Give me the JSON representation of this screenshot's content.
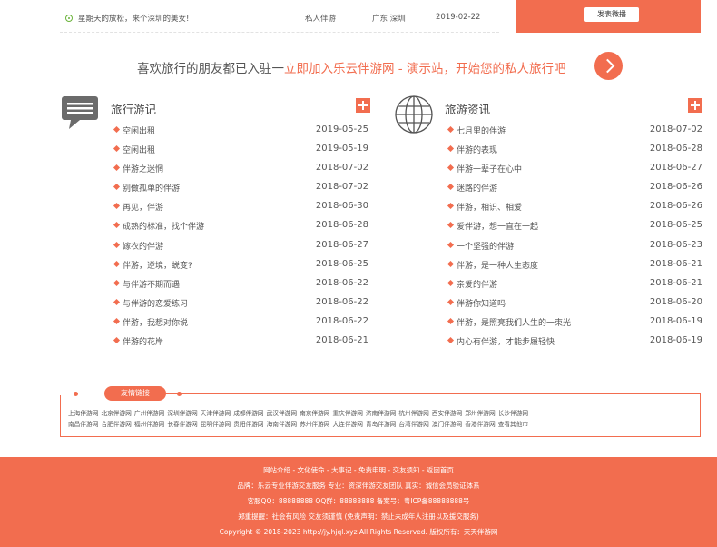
{
  "top_row": {
    "title": "星期天的放松，来个深圳的美女!",
    "category": "私人伴游",
    "location": "广东 深圳",
    "date": "2019-02-22",
    "post_button": "发表微播"
  },
  "banner": {
    "prefix": "喜欢旅行的朋友都已入驻一",
    "highlight": "立即加入乐云伴游网 - 演示站，开始您的私人旅行吧"
  },
  "travel_notes": {
    "title": "旅行游记",
    "icon": "chat-bubble-icon",
    "items": [
      {
        "title": "空闲出租",
        "date": "2019-05-25"
      },
      {
        "title": "空闲出租",
        "date": "2019-05-19"
      },
      {
        "title": "伴游之迷惘",
        "date": "2018-07-02"
      },
      {
        "title": "别做孤单的伴游",
        "date": "2018-07-02"
      },
      {
        "title": "再见，伴游",
        "date": "2018-06-30"
      },
      {
        "title": "成熟的标准，找个伴游",
        "date": "2018-06-28"
      },
      {
        "title": "嫁衣的伴游",
        "date": "2018-06-27"
      },
      {
        "title": "伴游，逆境，蜕变?",
        "date": "2018-06-25"
      },
      {
        "title": "与伴游不期而遇",
        "date": "2018-06-22"
      },
      {
        "title": "与伴游的恋爱练习",
        "date": "2018-06-22"
      },
      {
        "title": "伴游，我想对你说",
        "date": "2018-06-22"
      },
      {
        "title": "伴游的花岸",
        "date": "2018-06-21"
      }
    ]
  },
  "travel_news": {
    "title": "旅游资讯",
    "icon": "globe-icon",
    "items": [
      {
        "title": "七月里的伴游",
        "date": "2018-07-02"
      },
      {
        "title": "伴游的表现",
        "date": "2018-06-28"
      },
      {
        "title": "伴游一辈子在心中",
        "date": "2018-06-27"
      },
      {
        "title": "迷路的伴游",
        "date": "2018-06-26"
      },
      {
        "title": "伴游，相识、相爱",
        "date": "2018-06-26"
      },
      {
        "title": "爱伴游，想一直在一起",
        "date": "2018-06-25"
      },
      {
        "title": "一个坚强的伴游",
        "date": "2018-06-23"
      },
      {
        "title": "伴游，是一种人生态度",
        "date": "2018-06-21"
      },
      {
        "title": "亲爱的伴游",
        "date": "2018-06-21"
      },
      {
        "title": "伴游你知道吗",
        "date": "2018-06-20"
      },
      {
        "title": "伴游，是照亮我们人生的一束光",
        "date": "2018-06-19"
      },
      {
        "title": "内心有伴游，才能步履轻快",
        "date": "2018-06-19"
      }
    ]
  },
  "friend_links": {
    "tag": "友情链接",
    "row1": [
      "上海伴游网",
      "北京伴游网",
      "广州伴游网",
      "深圳伴游网",
      "天津伴游网",
      "成都伴游网",
      "武汉伴游网",
      "南京伴游网",
      "重庆伴游网",
      "济南伴游网",
      "杭州伴游网",
      "西安伴游网",
      "郑州伴游网",
      "长沙伴游网"
    ],
    "row2": [
      "南昌伴游网",
      "合肥伴游网",
      "福州伴游网",
      "长春伴游网",
      "昆明伴游网",
      "贵阳伴游网",
      "海南伴游网",
      "苏州伴游网",
      "大连伴游网",
      "青岛伴游网",
      "台湾伴游网",
      "澳门伴游网",
      "香港伴游网",
      "查看其他市"
    ]
  },
  "footer": {
    "nav": "网站介绍 - 文化使命 - 大事记 - 免责申明 - 交友须知 - 返回首页",
    "brand": "品牌：乐云专业伴游交友服务 专业：资深伴游交友团队 真实：诚信会员验证体系",
    "contact": "客服QQ：88888888 QQ群：88888888 备案号：粤ICP备88888888号",
    "notice": "郑重提醒：社会有风险 交友须谨慎 (免责声明：禁止未成年人注册以及援交服务)",
    "copyright": "Copyright © 2018-2023 http://jy.hjql.xyz All Rights Reserved. 版权所有：天天伴游网"
  },
  "colors": {
    "accent": "#f26d4f",
    "bullet_green": "#6ab33a"
  }
}
